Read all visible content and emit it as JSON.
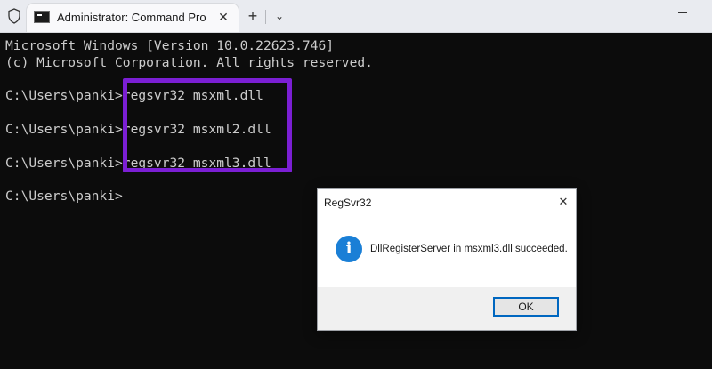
{
  "window": {
    "tab_title": "Administrator: Command Pro",
    "close_glyph": "✕",
    "new_tab_glyph": "+",
    "dropdown_glyph": "⌄"
  },
  "terminal": {
    "lines": [
      "Microsoft Windows [Version 10.0.22623.746]",
      "(c) Microsoft Corporation. All rights reserved.",
      "",
      "C:\\Users\\panki>regsvr32 msxml.dll",
      "",
      "C:\\Users\\panki>regsvr32 msxml2.dll",
      "",
      "C:\\Users\\panki>regsvr32 msxml3.dll",
      "",
      "C:\\Users\\panki>"
    ]
  },
  "dialog": {
    "title": "RegSvr32",
    "close_glyph": "✕",
    "icon_glyph": "i",
    "message": "DllRegisterServer in msxml3.dll succeeded.",
    "ok_label": "OK"
  },
  "colors": {
    "highlight": "#7b1fd4",
    "terminal_bg": "#0c0c0c",
    "terminal_text": "#cccccc",
    "info_icon": "#1a7fd6"
  }
}
